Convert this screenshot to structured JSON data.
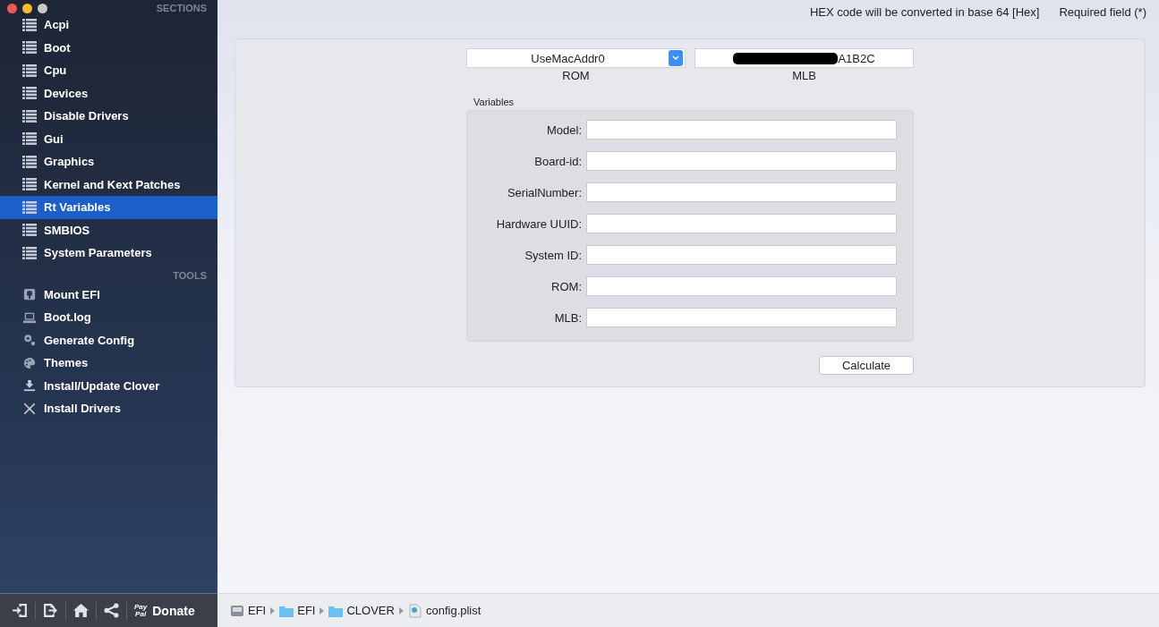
{
  "window": {
    "buttons": [
      {
        "color": "#ee5a52"
      },
      {
        "color": "#f5bd2f"
      },
      {
        "color": "#c8c8c8"
      }
    ]
  },
  "sidebar": {
    "sections_heading": "SECTIONS",
    "sections": [
      {
        "label": "Acpi",
        "selected": false
      },
      {
        "label": "Boot",
        "selected": false
      },
      {
        "label": "Cpu",
        "selected": false
      },
      {
        "label": "Devices",
        "selected": false
      },
      {
        "label": "Disable Drivers",
        "selected": false
      },
      {
        "label": "Gui",
        "selected": false
      },
      {
        "label": "Graphics",
        "selected": false
      },
      {
        "label": "Kernel and Kext Patches",
        "selected": false
      },
      {
        "label": "Rt Variables",
        "selected": true
      },
      {
        "label": "SMBIOS",
        "selected": false
      },
      {
        "label": "System Parameters",
        "selected": false
      }
    ],
    "tools_heading": "TOOLS",
    "tools": [
      {
        "label": "Mount EFI",
        "kind": "disk"
      },
      {
        "label": "Boot.log",
        "kind": "laptop"
      },
      {
        "label": "Generate Config",
        "kind": "gears"
      },
      {
        "label": "Themes",
        "kind": "palette"
      },
      {
        "label": "Install/Update Clover",
        "kind": "download"
      },
      {
        "label": "Install Drivers",
        "kind": "tools"
      }
    ],
    "bottom_bar": {
      "buttons": [
        {
          "kind": "import"
        },
        {
          "kind": "export"
        },
        {
          "kind": "home"
        },
        {
          "kind": "share"
        }
      ],
      "paypal_logo": [
        "Pay",
        "Pal"
      ],
      "donate": "Donate"
    }
  },
  "header": {
    "hex_note": "HEX code will be converted in base 64 [Hex]",
    "required_note": "Required field (*)"
  },
  "rom": {
    "value": "UseMacAddr0",
    "label": "ROM"
  },
  "mlb": {
    "value": "A1B2C",
    "redacted": true,
    "label": "MLB"
  },
  "variables": {
    "title": "Variables",
    "fields": [
      {
        "label": "Model:"
      },
      {
        "label": "Board-id:"
      },
      {
        "label": "SerialNumber:"
      },
      {
        "label": "Hardware UUID:"
      },
      {
        "label": "System ID:"
      },
      {
        "label": "ROM:"
      },
      {
        "label": "MLB:"
      }
    ]
  },
  "calculate_button": "Calculate",
  "path_bar": [
    {
      "label": "EFI",
      "kind": "disk"
    },
    {
      "label": "EFI",
      "kind": "folder"
    },
    {
      "label": "CLOVER",
      "kind": "folder"
    },
    {
      "label": "config.plist",
      "kind": "file"
    }
  ]
}
